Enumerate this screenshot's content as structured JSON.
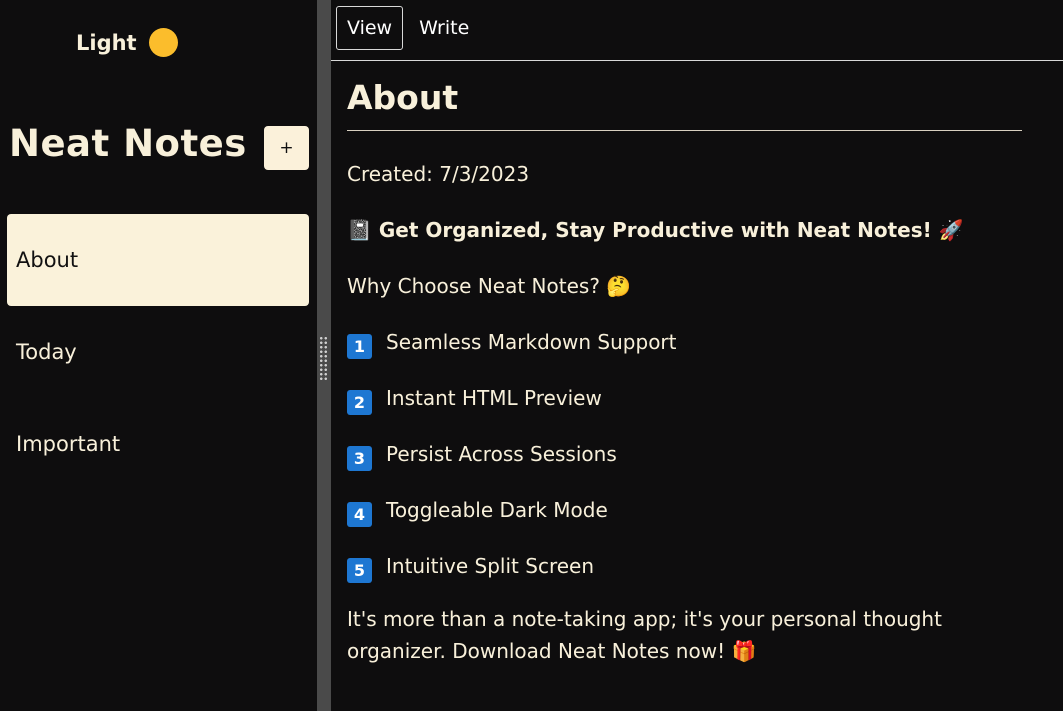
{
  "sidebar": {
    "theme_label": "Light",
    "theme_icon": "sun-icon",
    "title": "Neat Notes",
    "add_label": "+",
    "notes": [
      {
        "label": "About",
        "active": true
      },
      {
        "label": "Today",
        "active": false
      },
      {
        "label": "Important",
        "active": false
      }
    ]
  },
  "tabs": [
    {
      "label": "View",
      "active": true
    },
    {
      "label": "Write",
      "active": false
    }
  ],
  "note": {
    "title": "About",
    "created": "Created: 7/3/2023",
    "headline": "📓 Get Organized, Stay Productive with Neat Notes! 🚀",
    "question": "Why Choose Neat Notes? 🤔",
    "features": [
      {
        "num": "1",
        "text": "Seamless Markdown Support"
      },
      {
        "num": "2",
        "text": "Instant HTML Preview"
      },
      {
        "num": "3",
        "text": "Persist Across Sessions"
      },
      {
        "num": "4",
        "text": "Toggleable Dark Mode"
      },
      {
        "num": "5",
        "text": "Intuitive Split Screen"
      }
    ],
    "closing": "It's more than a note-taking app; it's your personal thought organizer. Download Neat Notes now! 🎁"
  },
  "colors": {
    "background": "#0e0d0e",
    "text": "#f8f0da",
    "active_item_bg": "#faf2da",
    "sun": "#fbbd2c",
    "number_badge": "#1e77d2",
    "gutter": "#4a4a4a"
  }
}
